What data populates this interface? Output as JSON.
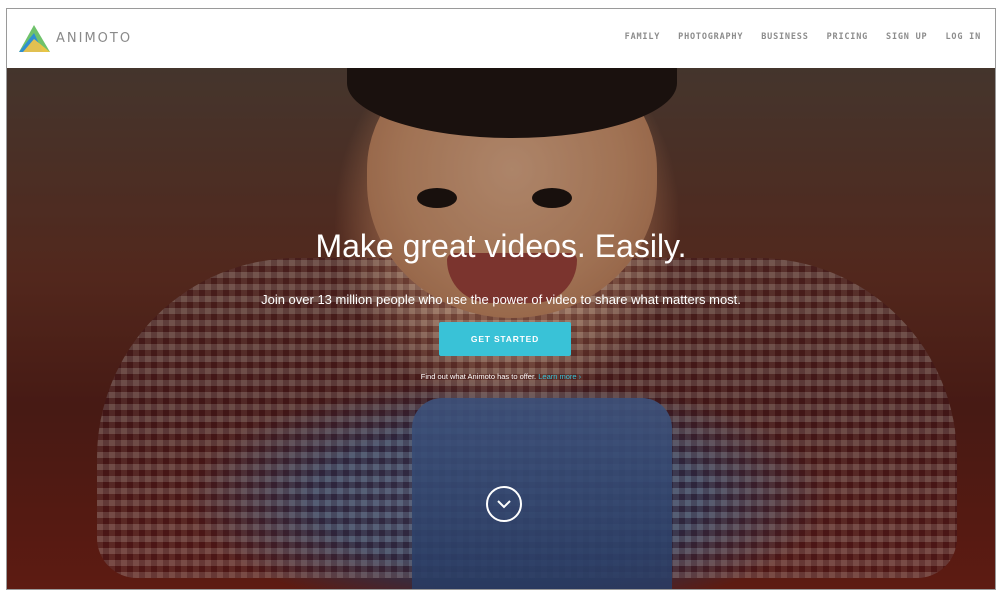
{
  "brand": {
    "name": "ANIMOTO"
  },
  "nav": {
    "items": [
      {
        "label": "FAMILY"
      },
      {
        "label": "PHOTOGRAPHY"
      },
      {
        "label": "BUSINESS"
      },
      {
        "label": "PRICING"
      },
      {
        "label": "SIGN UP"
      },
      {
        "label": "LOG IN"
      }
    ]
  },
  "hero": {
    "title": "Make great videos. Easily.",
    "subtitle": "Join over 13 million people who use the power of video to share what matters most.",
    "cta_label": "GET STARTED",
    "more_text": "Find out what Animoto has to offer.",
    "more_link": "Learn more ›",
    "scroll_icon": "chevron-down-circle-icon"
  },
  "colors": {
    "accent": "#39c2d7"
  }
}
